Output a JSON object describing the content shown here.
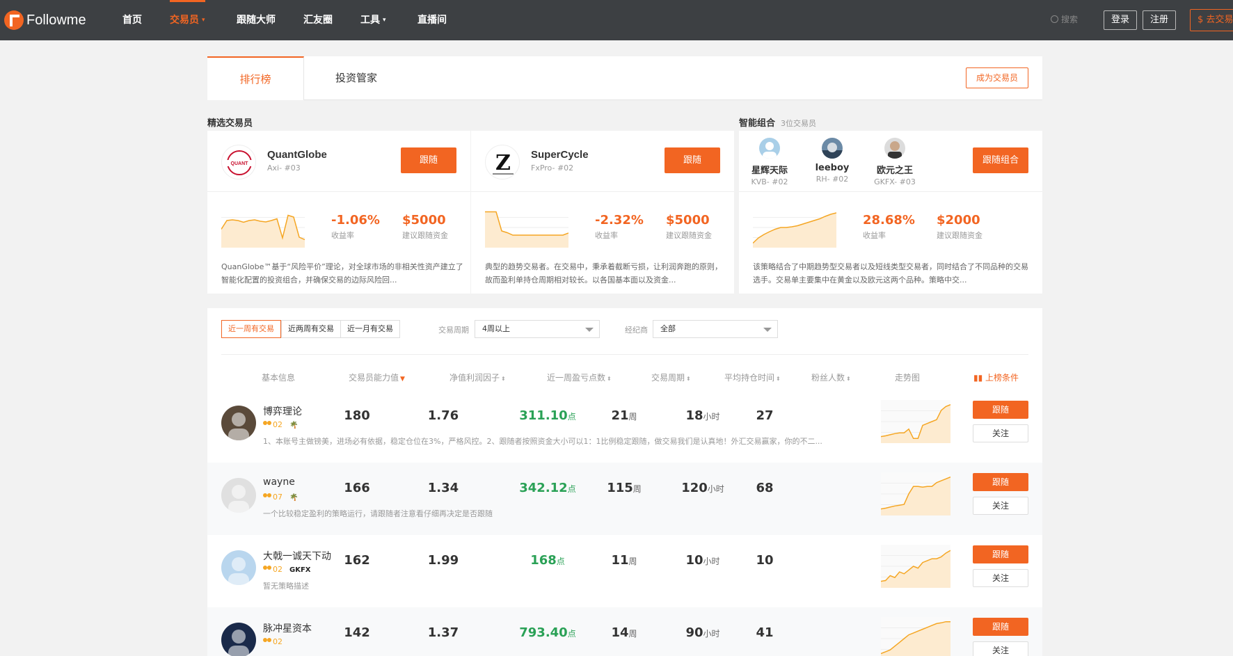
{
  "nav": {
    "logo": "Followme",
    "items": [
      {
        "label": "首页"
      },
      {
        "label": "交易员",
        "caret": true
      },
      {
        "label": "跟随大师"
      },
      {
        "label": "汇友圈"
      },
      {
        "label": "工具",
        "caret": true
      },
      {
        "label": "直播间"
      }
    ],
    "search_label": "搜索",
    "login": "登录",
    "register": "注册",
    "copy_button": "$ 去交易"
  },
  "tabs": {
    "active": "排行榜",
    "second": "投资管家",
    "become_trader": "成为交易员"
  },
  "featured": {
    "title": "精选交易员",
    "cards": [
      {
        "name": "QuantGlobe",
        "broker": "Axi- #03",
        "follow": "跟随",
        "return": "-1.06%",
        "return_label": "收益率",
        "fund": "$5000",
        "fund_label": "建议跟随资金",
        "description": "QuanGlobe™基于“风险平价”理论，对全球市场的非相关性资产建立了智能化配置的投资组合，并确保交易的边际风险回...",
        "spark": [
          0.55,
          0.3,
          0.28,
          0.3,
          0.35,
          0.3,
          0.28,
          0.32,
          0.34,
          0.3,
          0.25,
          0.8,
          0.15,
          0.2,
          0.78,
          0.85
        ]
      },
      {
        "name": "SuperCycle",
        "broker": "FxPro- #02",
        "follow": "跟随",
        "return": "-2.32%",
        "return_label": "收益率",
        "fund": "$5000",
        "fund_label": "建议跟随资金",
        "description": "典型的趋势交易者。在交易中，秉承着截断亏损，让利润奔跑的原则，故而盈利单持仓周期相对较长。以各国基本面以及资金...",
        "spark": [
          0.05,
          0.05,
          0.05,
          0.6,
          0.65,
          0.72,
          0.72,
          0.72,
          0.72,
          0.72,
          0.72,
          0.72,
          0.72,
          0.72,
          0.72,
          0.66
        ]
      }
    ]
  },
  "combo": {
    "title": "智能组合",
    "subtitle": "3位交易员",
    "members": [
      {
        "name": "星辉天际",
        "broker": "KVB- #02"
      },
      {
        "name": "leeboy",
        "broker": "RH- #02"
      },
      {
        "name": "欧元之王",
        "broker": "GKFX- #03"
      }
    ],
    "follow": "跟随组合",
    "return": "28.68%",
    "return_label": "收益率",
    "fund": "$2000",
    "fund_label": "建议跟随资金",
    "description": "该策略结合了中期趋势型交易者以及短线类型交易者，同时结合了不同品种的交易选手。交易单主要集中在黄金以及欧元这两个品种。策略中交...",
    "spark": [
      0.95,
      0.8,
      0.7,
      0.62,
      0.55,
      0.5,
      0.5,
      0.48,
      0.45,
      0.4,
      0.35,
      0.3,
      0.25,
      0.18,
      0.12,
      0.08
    ]
  },
  "filters": {
    "segments": [
      "近一周有交易",
      "近两周有交易",
      "近一月有交易"
    ],
    "period_label": "交易周期",
    "period_value": "4周以上",
    "broker_label": "经纪商",
    "broker_value": "全部"
  },
  "table": {
    "headers": [
      "基本信息",
      "交易员能力值",
      "净值利润因子",
      "近一周盈亏点数",
      "交易周期",
      "平均持仓时间",
      "粉丝人数",
      "走势图",
      "上榜条件"
    ],
    "follow_label": "跟随",
    "watch_label": "关注",
    "rows": [
      {
        "name": "博弈理论",
        "level": "02",
        "broker": "🌴",
        "desc": "1、本账号主做镑美，进场必有依据，稳定仓位在3%，严格风控。2、跟随者按照资金大小可以1：1比例稳定跟随，做交易我们是认真地！外汇交易赢家，你的不二...",
        "ability": "180",
        "factor": "1.76",
        "points": "311.10",
        "points_unit": "点",
        "period": "21",
        "period_unit": "周",
        "hold": "18",
        "hold_unit": "小时",
        "fans": "27",
        "spark": [
          0.9,
          0.88,
          0.85,
          0.82,
          0.8,
          0.8,
          0.7,
          0.95,
          0.95,
          0.6,
          0.55,
          0.5,
          0.45,
          0.2,
          0.1,
          0.05
        ]
      },
      {
        "name": "wayne",
        "level": "07",
        "broker": "🌴",
        "desc": "一个比较稳定盈利的策略运行，请跟随者注意看仔细再决定是否跟随",
        "ability": "166",
        "factor": "1.34",
        "points": "342.12",
        "points_unit": "点",
        "period": "115",
        "period_unit": "周",
        "hold": "120",
        "hold_unit": "小时",
        "fans": "68",
        "spark": [
          0.9,
          0.88,
          0.85,
          0.82,
          0.8,
          0.78,
          0.5,
          0.3,
          0.3,
          0.32,
          0.3,
          0.3,
          0.2,
          0.15,
          0.1,
          0.05
        ]
      },
      {
        "name": "大戟一诚天下动",
        "level": "02",
        "broker": "GKFX",
        "desc": "暂无策略描述",
        "ability": "162",
        "factor": "1.99",
        "points": "168",
        "points_unit": "点",
        "period": "11",
        "period_unit": "周",
        "hold": "10",
        "hold_unit": "小时",
        "fans": "10",
        "spark": [
          0.9,
          0.88,
          0.75,
          0.8,
          0.65,
          0.7,
          0.6,
          0.5,
          0.55,
          0.4,
          0.35,
          0.3,
          0.3,
          0.25,
          0.15,
          0.08
        ]
      },
      {
        "name": "脉冲星资本",
        "level": "02",
        "broker": "",
        "desc": "",
        "ability": "142",
        "factor": "1.37",
        "points": "793.40",
        "points_unit": "点",
        "period": "14",
        "period_unit": "周",
        "hold": "90",
        "hold_unit": "小时",
        "fans": "41",
        "spark": [
          0.9,
          0.85,
          0.8,
          0.7,
          0.6,
          0.5,
          0.4,
          0.35,
          0.3,
          0.25,
          0.2,
          0.15,
          0.1,
          0.08,
          0.05,
          0.05
        ]
      }
    ]
  },
  "colors": {
    "accent": "#f26522",
    "green": "#2aa156",
    "nav_bg": "#3d4043"
  }
}
